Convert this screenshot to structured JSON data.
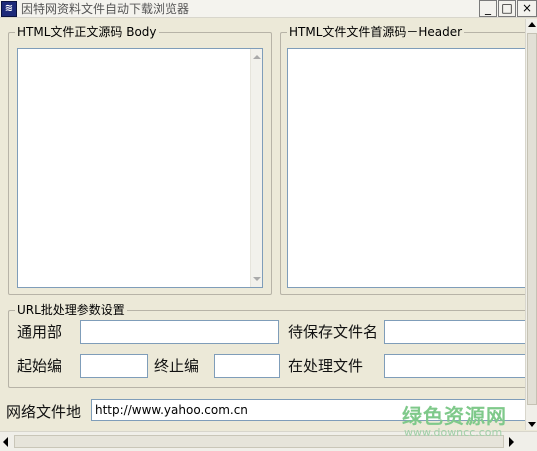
{
  "window": {
    "title": "因特网资料文件自动下载浏览器",
    "app_icon": "app-logo-icon",
    "controls": {
      "minimize": "_",
      "maximize": "□",
      "close": "×"
    }
  },
  "body_group": {
    "label": "HTML文件正文源码 Body"
  },
  "header_group": {
    "label": "HTML文件文件首源码－Header"
  },
  "url_group": {
    "label": "URL批处理参数设置",
    "common_label": "通用部",
    "common_value": "",
    "pending_label": "待保存文件名",
    "pending_value": "",
    "start_label": "起始编",
    "start_value": "",
    "end_label": "终止编",
    "end_value": "",
    "processing_label": "在处理文件",
    "processing_value": ""
  },
  "address": {
    "label": "网络文件地",
    "value": "http://www.yahoo.com.cn"
  },
  "watermark": {
    "main": "绿色资源网",
    "sub": "www.downcc.com"
  },
  "colors": {
    "window_bg": "#ece9d8",
    "input_border": "#7f9db9",
    "watermark": "#7fc98a"
  }
}
